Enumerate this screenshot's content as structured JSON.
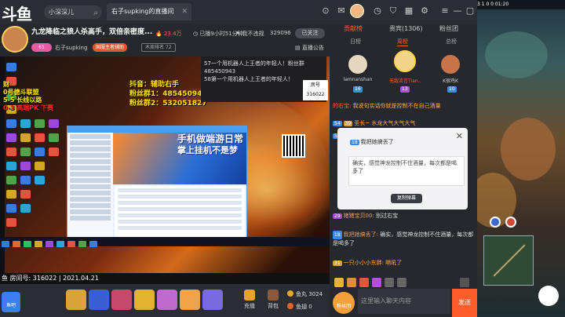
{
  "topbar": {
    "logo": "斗鱼",
    "search_value": "小深深儿",
    "tab_title": "右子supking的直播间"
  },
  "room": {
    "title": "九龙降临之狼人杀高手，双倍亲密度...",
    "hot": "23.4万",
    "runtime": "已播9小时51分钟",
    "report": "我不违规",
    "follow_count": "329096",
    "follow_label": "已关注",
    "level": "61",
    "streamer": "右子supking",
    "category": "国服主者辅助",
    "rank": "木周排名 72",
    "announcement": "直播公告",
    "room_id_label": "房间号: 316022 | 2021.04.21"
  },
  "overlay": {
    "left_text_1": "财",
    "left_text_2": "0号德斗联盟",
    "left_text_3": "5-5 长线以路",
    "left_text_4": "0-3 高端PK 下赛",
    "streamer_line1": "抖音：辅助右手",
    "streamer_line2": "粉丝群1：485450943",
    "streamer_line3": "粉丝群2：532051827",
    "notice1": "57一个用机器人上王者的年轻人！粉丝群485450943",
    "notice2": "58第一个用机器人上王者的年轻人！",
    "room_mini_1": "房号",
    "room_mini_2": "316022",
    "ad_title": "手机做端游日常",
    "ad_sub": "掌上挂机不是梦"
  },
  "gift_bar": {
    "sub_label": "鱼吧",
    "recharge": "充值",
    "backpack": "背包",
    "fish_balls": "鱼丸 3024",
    "fish_wings": "鱼翅 0"
  },
  "panel": {
    "tabs": [
      "贡献榜",
      "贵宾(1306)",
      "粉丝团"
    ],
    "sub_tabs": [
      "日榜",
      "周榜",
      "总榜"
    ],
    "ranks": [
      {
        "name": "lamnanshan",
        "level": "16"
      },
      {
        "name": "无敌流言Tian...",
        "level": "13"
      },
      {
        "name": "K很鸡K",
        "level": "10"
      }
    ],
    "chat": [
      {
        "user": "的右宝:",
        "text": "我说句实话你就是控制不在自己酒量"
      },
      {
        "user": "",
        "text": "圣长~ 水龙大气大气大气"
      },
      {
        "user": "",
        "text": "请坐"
      },
      {
        "user": "猪猪宝贝00:",
        "text": "别过右宝"
      },
      {
        "user": "我把她搞丢了:",
        "text": "确实，感觉神龙控制不住酒量，每次都是喝多了"
      },
      {
        "user": "",
        "text": "一只小小小东胖: 嘶吼了"
      }
    ],
    "popup_user": "我把她搞丢了",
    "popup_text": "确实，感觉神龙控制不住酒量，每次都是喝多了",
    "popup_copy": "复制弹幕",
    "input_placeholder": "这里输入聊天内容",
    "send_label": "发送",
    "fans_label": "粉丝团"
  },
  "game": {
    "top_text": "3  1  0  0  01:20"
  }
}
